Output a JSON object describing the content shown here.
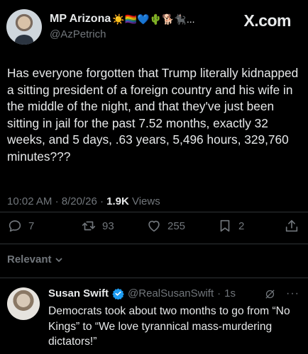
{
  "header": {
    "display_name": "MP Arizona",
    "name_emojis": "☀️🏳️‍🌈💙🌵🐕🐈‍⬛...",
    "handle": "@AzPetrich",
    "brand": "X.com"
  },
  "tweet": {
    "text": "Has everyone forgotten that Trump literally kidnapped a sitting president of a foreign country and his wife in the middle of the night, and that they've just been sitting in jail for the past 7.52 months, exactly 32 weeks, and 5 days, .63 years, 5,496 hours, 329,760 minutes???",
    "time": "10:02 AM",
    "date": "8/20/26",
    "views_count": "1.9K",
    "views_label": "Views"
  },
  "actions": {
    "replies": "7",
    "reposts": "93",
    "likes": "255",
    "bookmarks": "2"
  },
  "sort": {
    "label": "Relevant"
  },
  "reply": {
    "name": "Susan Swift",
    "handle": "@RealSusanSwift",
    "time": "1s",
    "text": "Democrats took about two months to go from “No Kings” to “We love tyrannical mass-murdering dictators!”"
  },
  "colors": {
    "background": "#000000",
    "text": "#e7e9ea",
    "secondary": "#71767b",
    "verified": "#1d9bf0"
  }
}
